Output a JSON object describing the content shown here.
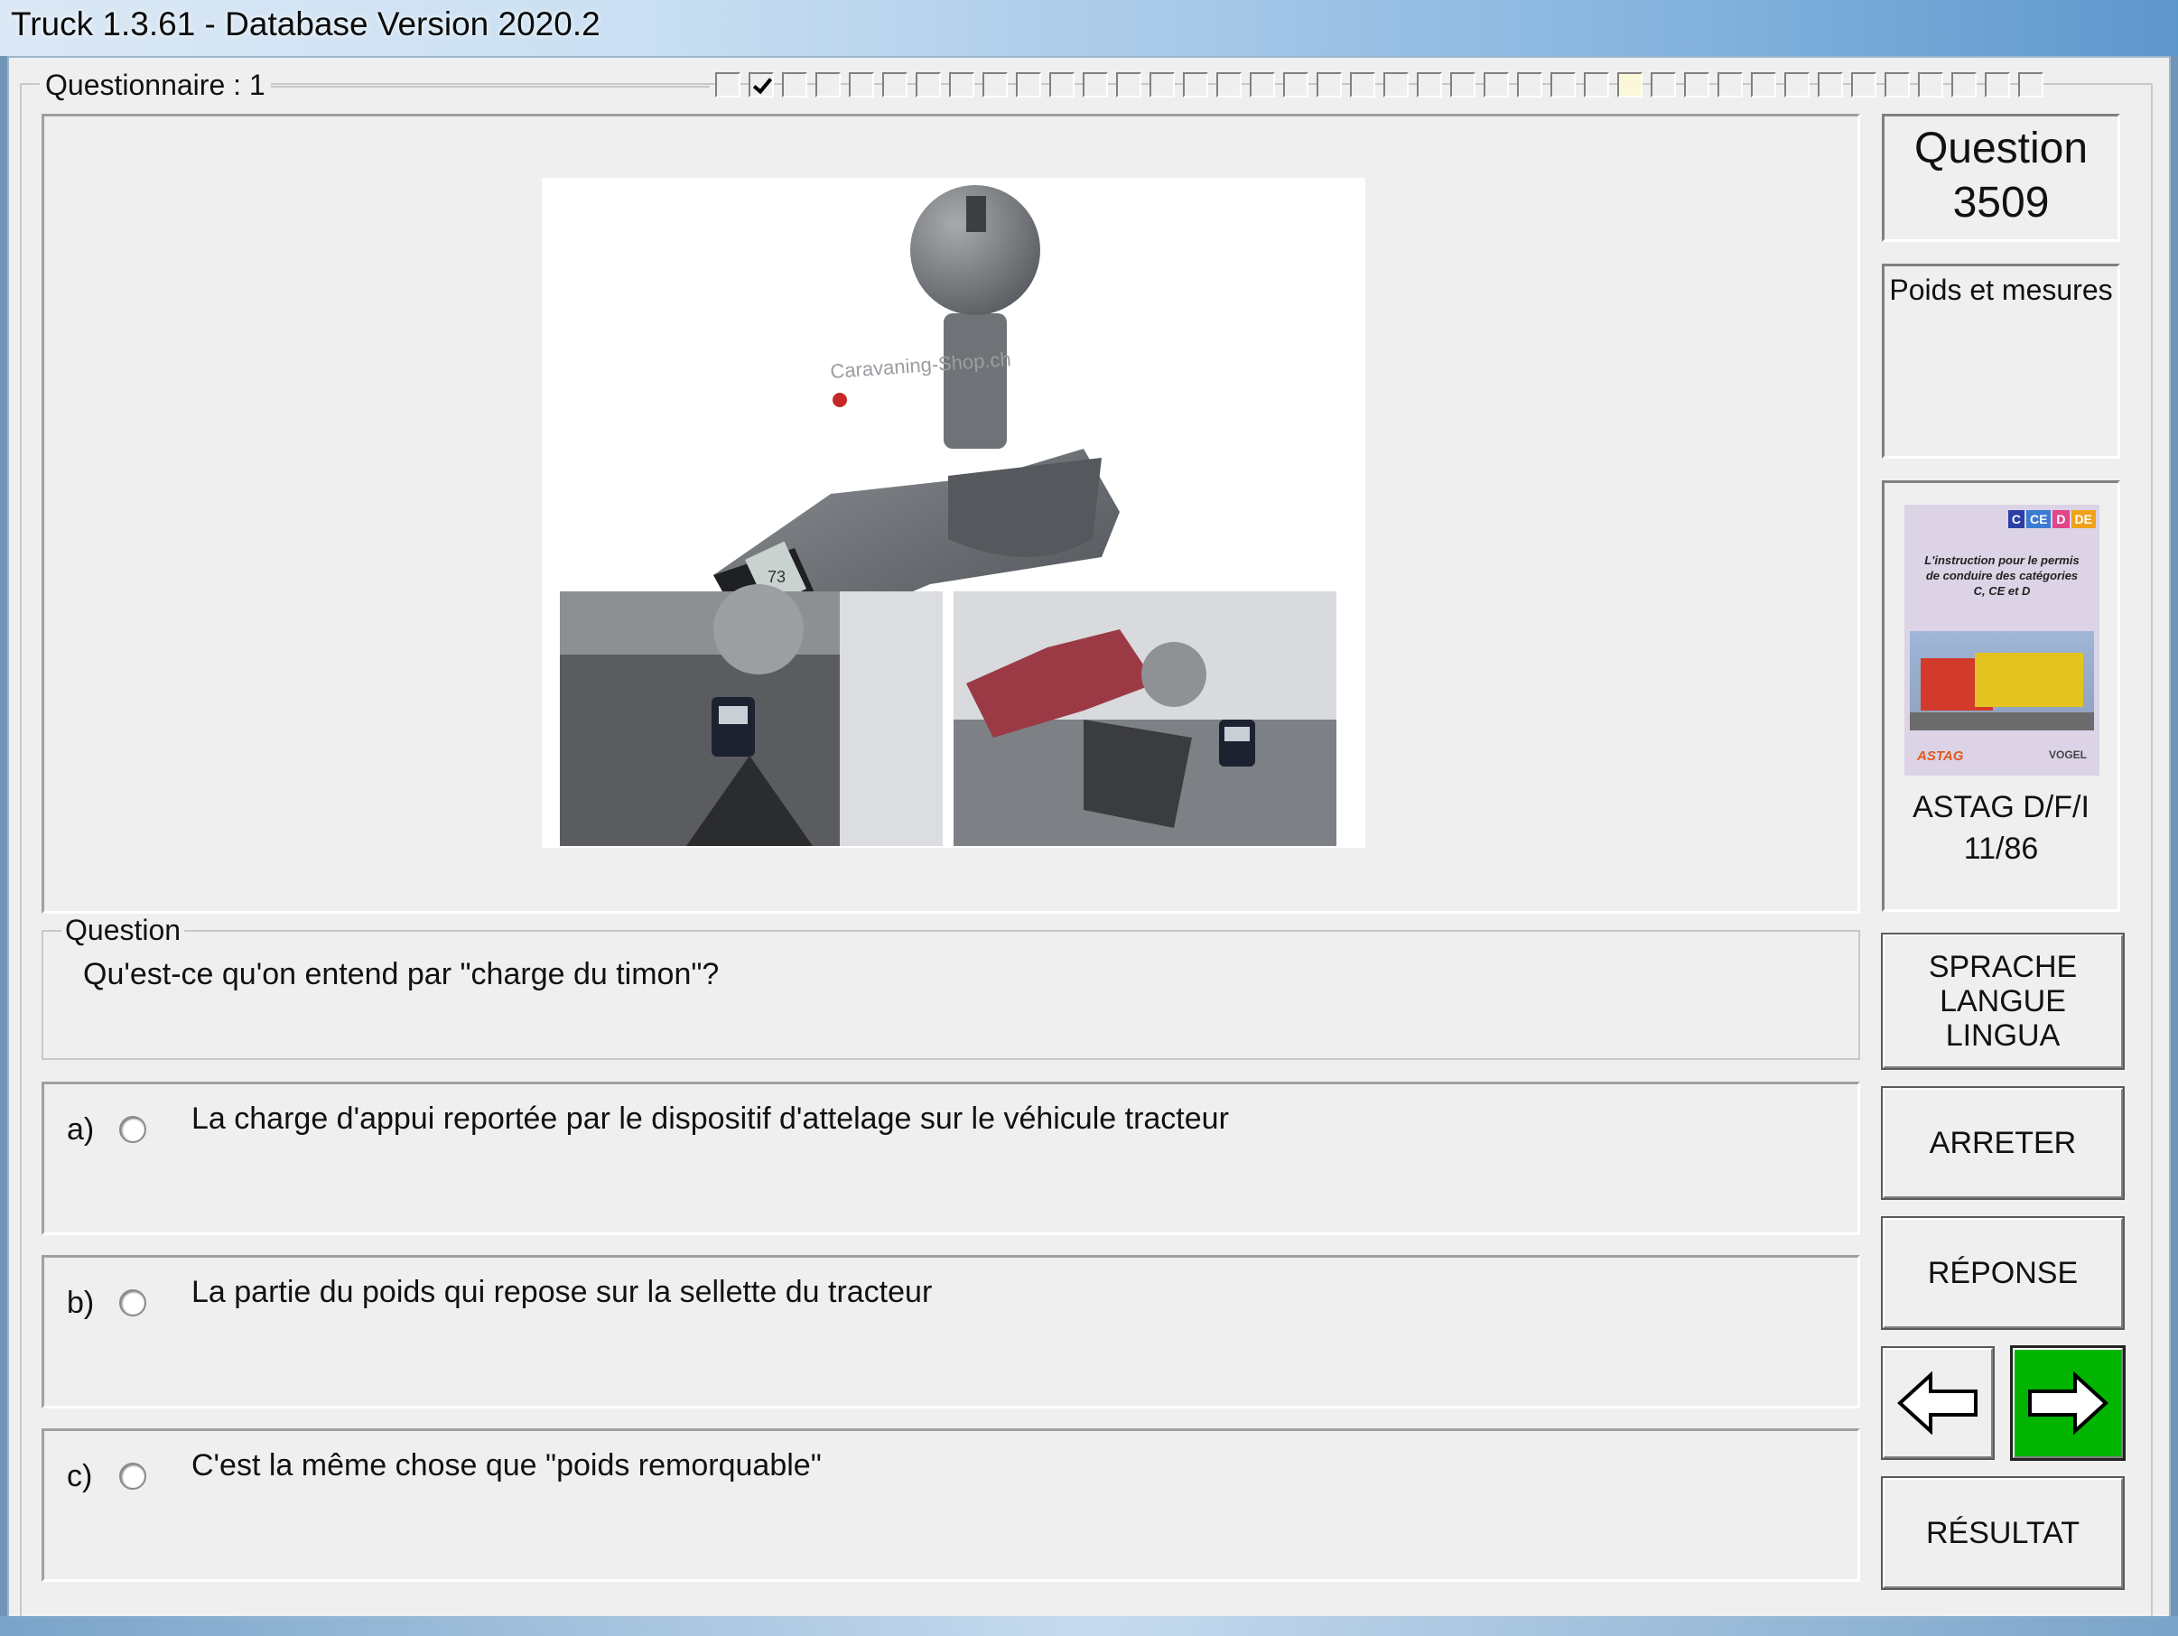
{
  "window": {
    "title": "Truck 1.3.61 - Database Version 2020.2"
  },
  "questionnaire": {
    "label": "Questionnaire : 1",
    "progress_total": 40,
    "progress_checked_index": 1,
    "progress_current_index": 27
  },
  "image": {
    "watermark": "Caravaning-Shop.ch",
    "display_value": "73",
    "alt_objects": [
      "tow-ball-scale-icon",
      "hitch-photo-left",
      "hitch-photo-right"
    ]
  },
  "question": {
    "legend": "Question",
    "text": "Qu'est-ce qu'on entend par \"charge du timon\"?"
  },
  "answers": [
    {
      "letter": "a)",
      "text": "La charge d'appui reportée par le dispositif d'attelage sur le véhicule tracteur"
    },
    {
      "letter": "b)",
      "text": "La partie du poids qui repose sur la sellette du tracteur"
    },
    {
      "letter": "c)",
      "text": "C'est la même chose que \"poids remorquable\""
    }
  ],
  "sidebar": {
    "question_label": "Question",
    "question_number": "3509",
    "category": "Poids et mesures",
    "book": {
      "badges": [
        "C",
        "CE",
        "D",
        "DE"
      ],
      "cover_text": "L'instruction pour le permis de conduire des catégories C, CE et D",
      "publisher_left": "ASTAG",
      "publisher_right": "VOGEL",
      "caption_line1": "ASTAG D/F/I",
      "caption_line2": "11/86"
    },
    "language_button": [
      "SPRACHE",
      "LANGUE",
      "LINGUA"
    ],
    "stop_button": "ARRETER",
    "answer_button": "RÉPONSE",
    "result_button": "RÉSULTAT"
  },
  "colors": {
    "next_button": "#00b400",
    "window_bg": "#efefef"
  }
}
